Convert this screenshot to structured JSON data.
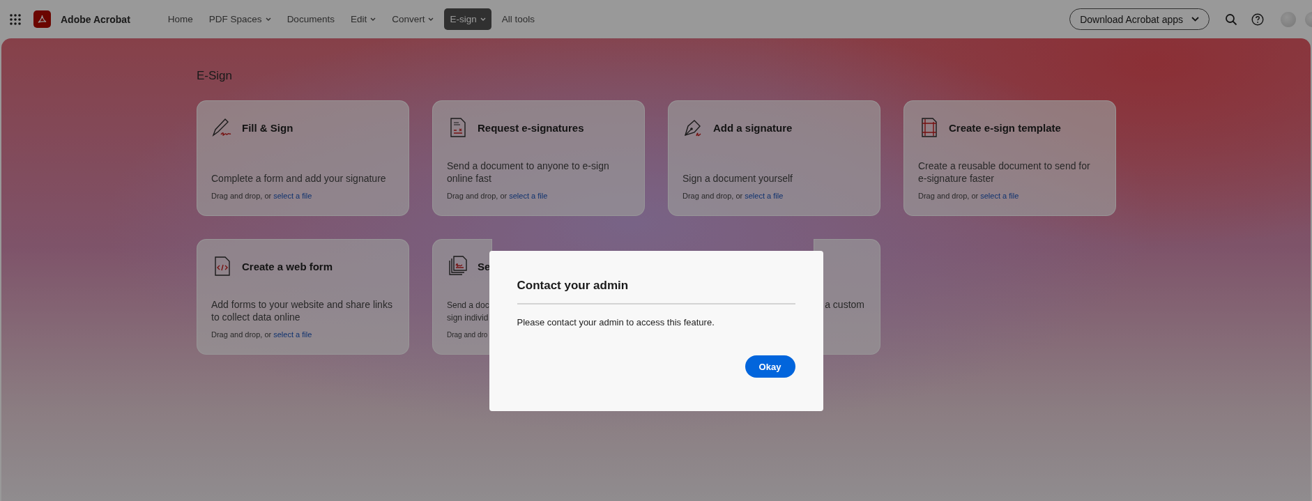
{
  "app": {
    "name": "Adobe Acrobat"
  },
  "nav": [
    {
      "label": "Home",
      "dropdown": false,
      "selected": false
    },
    {
      "label": "PDF Spaces",
      "dropdown": true,
      "selected": false
    },
    {
      "label": "Documents",
      "dropdown": false,
      "selected": false
    },
    {
      "label": "Edit",
      "dropdown": true,
      "selected": false
    },
    {
      "label": "Convert",
      "dropdown": true,
      "selected": false
    },
    {
      "label": "E-sign",
      "dropdown": true,
      "selected": true
    },
    {
      "label": "All tools",
      "dropdown": false,
      "selected": false
    }
  ],
  "download_button": {
    "label": "Download Acrobat apps"
  },
  "section_title": "E-Sign",
  "cards": [
    {
      "kind": "full",
      "title": "Fill & Sign",
      "description": "Complete a form and add your signature",
      "drop_text": "Drag and drop, or",
      "link": "select a file"
    },
    {
      "kind": "full",
      "title": "Request e-signatures",
      "description": "Send a document to anyone to e-sign online fast",
      "drop_text": "Drag and drop, or",
      "link": "select a file"
    },
    {
      "kind": "full",
      "title": "Add a signature",
      "description": "Sign a document yourself",
      "drop_text": "Drag and drop, or",
      "link": "select a file"
    },
    {
      "kind": "full",
      "title": "Create e-sign template",
      "description": "Create a reusable document to send for e-signature faster",
      "drop_text": "Drag and drop, or",
      "link": "select a file"
    },
    {
      "kind": "full",
      "title": "Create a web form",
      "description": "Add forms to your website and share links to collect data online",
      "drop_text": "Drag and drop, or",
      "link": "select a file"
    },
    {
      "kind": "covered_right",
      "title": "Se",
      "description_lines": [
        "Send a doc",
        "sign individ"
      ],
      "drop_text": "Drag and dro"
    },
    {
      "kind": "covered_left",
      "description_lines": [
        "a custom"
      ]
    }
  ],
  "dialog": {
    "title": "Contact your admin",
    "message": "Please contact your admin to access this feature.",
    "button": "Okay"
  }
}
